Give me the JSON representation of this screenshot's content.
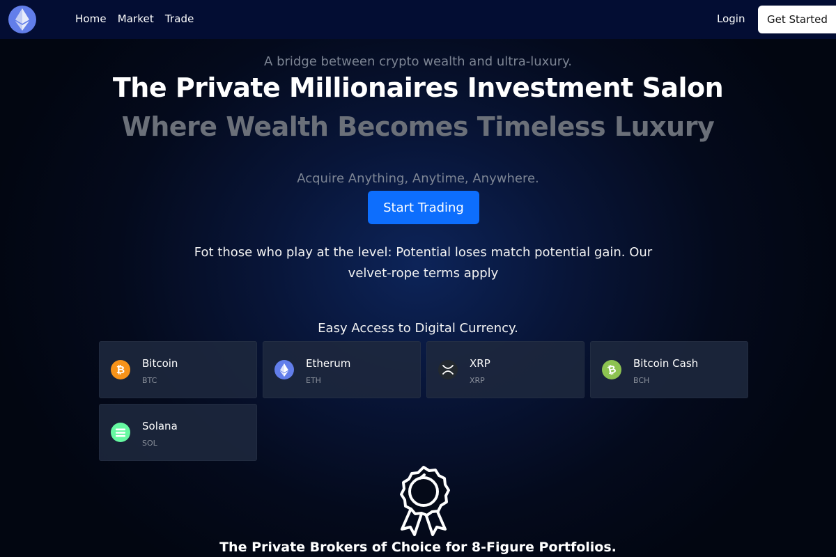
{
  "nav": {
    "logo_icon": "ethereum-logo-icon",
    "links": [
      "Home",
      "Market",
      "Trade"
    ],
    "login": "Login",
    "get_started": "Get Started"
  },
  "hero": {
    "tagline": "A bridge between crypto wealth and ultra-luxury.",
    "title": "The Private Millionaires Investment Salon",
    "subtitle": "Where Wealth Becomes Timeless Luxury",
    "acquire": "Acquire Anything, Anytime, Anywhere.",
    "cta": "Start Trading",
    "disclaimer": "Fot those who play at the level: Potential loses match potential gain. Our velvet-rope terms apply"
  },
  "currencies": {
    "title": "Easy Access to Digital Currency.",
    "items": [
      {
        "name": "Bitcoin",
        "symbol": "BTC",
        "icon": "bitcoin-icon",
        "color": "#f7931a"
      },
      {
        "name": "Etherum",
        "symbol": "ETH",
        "icon": "ethereum-icon",
        "color": "#627eea"
      },
      {
        "name": "XRP",
        "symbol": "XRP",
        "icon": "xrp-icon",
        "color": "#23292f"
      },
      {
        "name": "Bitcoin Cash",
        "symbol": "BCH",
        "icon": "bitcoin-cash-icon",
        "color": "#8dc351"
      },
      {
        "name": "Solana",
        "symbol": "SOL",
        "icon": "solana-icon",
        "color": "#66f9a1"
      }
    ]
  },
  "brokers": {
    "icon": "award-ribbon-icon",
    "title": "The Private Brokers of Choice for 8-Figure Portfolios."
  },
  "colors": {
    "nav_bg": "#030d33",
    "accent": "#0d6efd",
    "card_bg": "#1e283e"
  }
}
